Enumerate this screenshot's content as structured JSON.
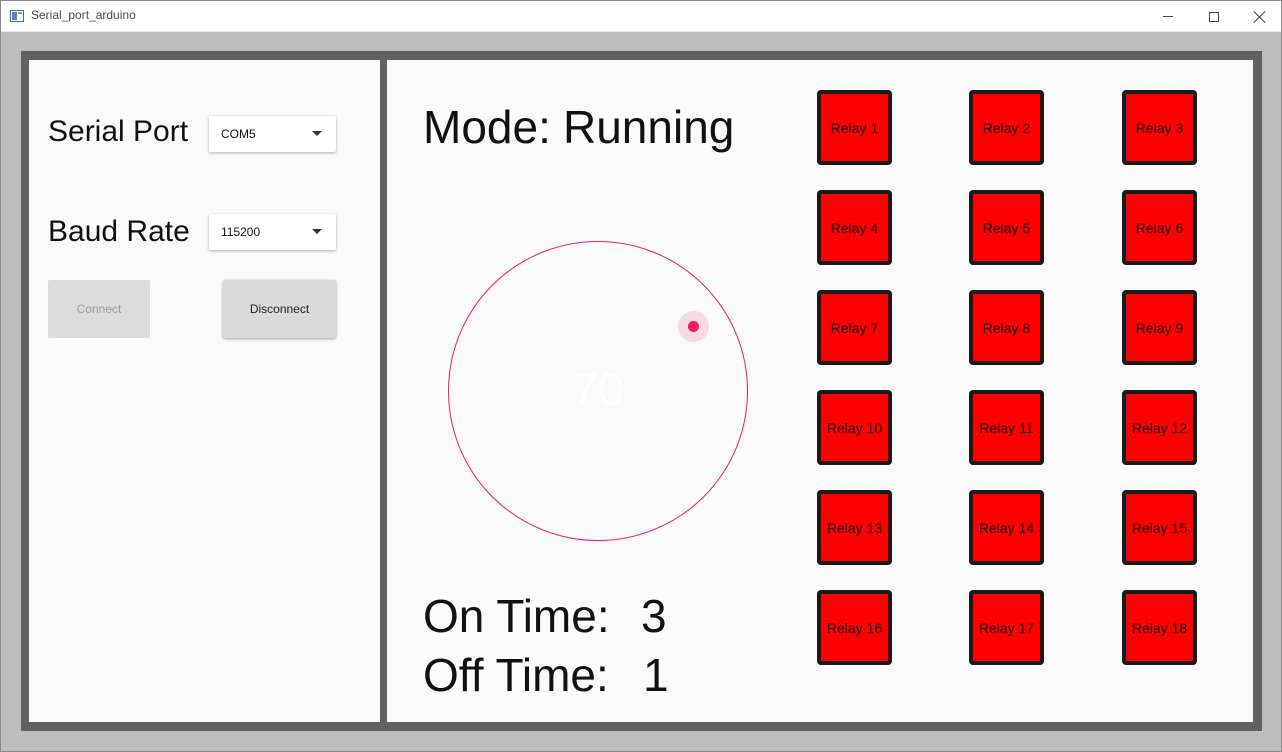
{
  "window": {
    "title": "Serial_port_arduino",
    "controls": [
      "minimize-icon",
      "maximize-icon",
      "close-icon"
    ]
  },
  "colors": {
    "relay_fill": "#ff0000",
    "accent": "#e91e63",
    "frame": "#616161"
  },
  "connection": {
    "serial_port_label": "Serial Port",
    "serial_port_value": "COM5",
    "baud_rate_label": "Baud Rate",
    "baud_rate_value": "115200",
    "connect_label": "Connect",
    "disconnect_label": "Disconnect"
  },
  "status": {
    "mode_label": "Mode:",
    "mode_value": "Running",
    "dial_value": "70",
    "on_time_label": "On Time:",
    "on_time_value": "3",
    "off_time_label": "Off Time:",
    "off_time_value": "1"
  },
  "relays": [
    "Relay 1",
    "Relay 2",
    "Relay 3",
    "Relay 4",
    "Relay 5",
    "Relay 6",
    "Relay 7",
    "Relay 8",
    "Relay 9",
    "Relay 10",
    "Relay 11",
    "Relay 12",
    "Relay 13",
    "Relay 14",
    "Relay 15",
    "Relay 16",
    "Relay 17",
    "Relay 18"
  ]
}
